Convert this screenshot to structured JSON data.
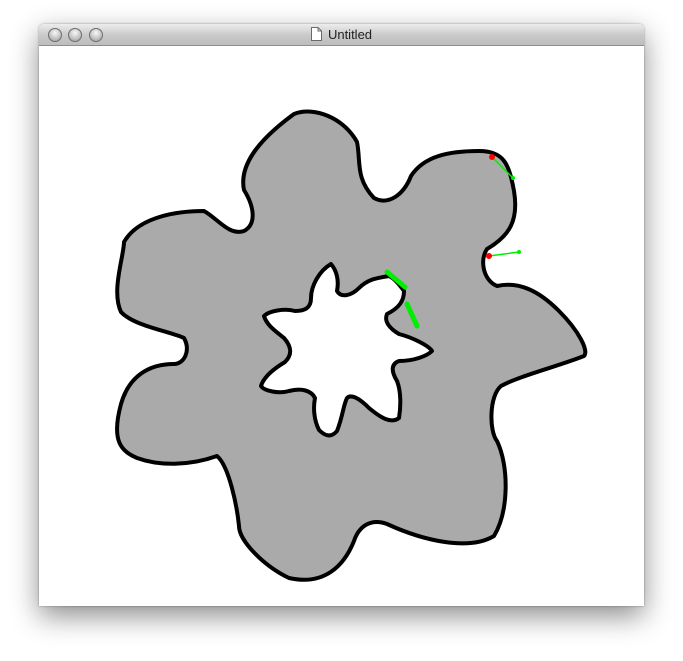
{
  "window": {
    "title": "Untitled",
    "title_icon": "document-icon"
  },
  "canvas": {
    "shape_fill": "#aaaaaa",
    "shape_stroke": "#000000",
    "handle_line_color": "#00ee00",
    "anchor_point_color": "#ff0000"
  }
}
